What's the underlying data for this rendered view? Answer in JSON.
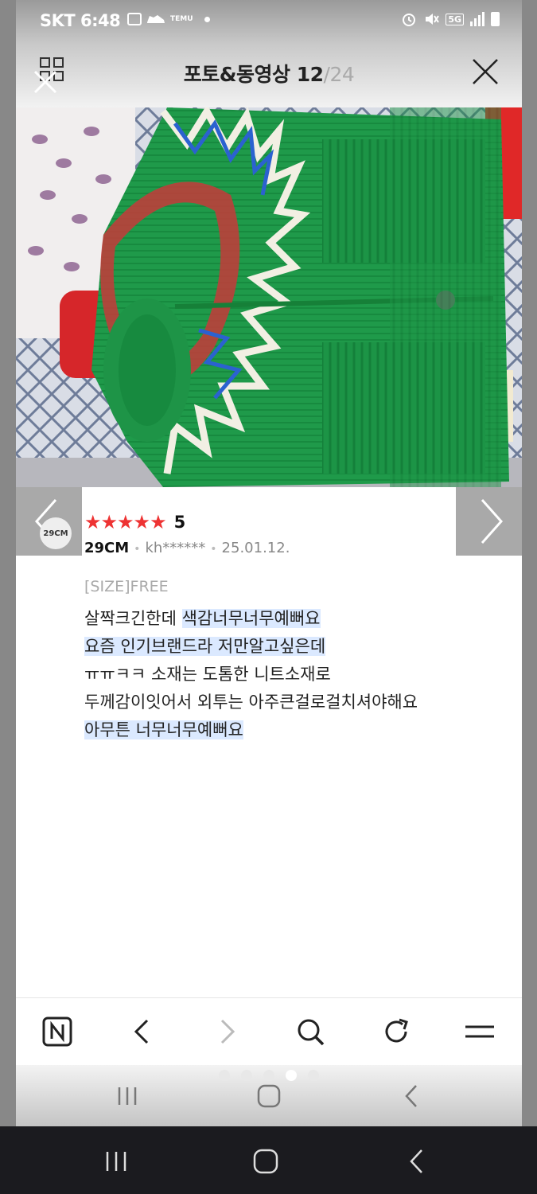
{
  "status_bar": {
    "time": "SKT 6:48",
    "left_icons": [
      "gallery-icon",
      "sneaker-icon",
      "temu-icon",
      "dot-icon"
    ],
    "temu_label": "TEMU",
    "network": "5G",
    "right_icons": [
      "alarm-icon",
      "mute-icon",
      "5g-icon",
      "signal-icon",
      "battery-icon"
    ]
  },
  "header": {
    "title": "포토&동영상",
    "current": "12",
    "separator": "/",
    "total": "24",
    "left_icon": "grid-icon",
    "close_icon": "close-icon"
  },
  "photo": {
    "description_icon": "review-photo"
  },
  "review": {
    "brand_logo_text": "29CM",
    "rating": "5",
    "stars": 5,
    "brand": "29CM",
    "user": "kh******",
    "date": "25.01.12.",
    "size": "[SIZE]FREE",
    "lines": [
      {
        "plain": "살짝크긴한데 ",
        "highlight": "색감너무너무예뻐요"
      },
      {
        "plain": "",
        "highlight": "요즘 인기브랜드라 저만알고싶은데"
      },
      {
        "plain": "ㅠㅠㅋㅋ 소재는 도톰한 니트소재로",
        "highlight": ""
      },
      {
        "plain": "두께감이잇어서 외투는 아주큰걸로걸치셔야해요",
        "highlight": ""
      },
      {
        "plain": "",
        "highlight": "아무튼 너무너무예뻐요"
      }
    ]
  },
  "toolbar": {
    "buttons": [
      "naver-home-icon",
      "back-icon",
      "forward-icon",
      "search-icon",
      "refresh-icon",
      "menu-icon"
    ]
  },
  "page_dots": {
    "count": 5,
    "active_index": 3
  },
  "nav": {
    "buttons": [
      "recents-icon",
      "home-icon",
      "back-icon"
    ]
  },
  "colors": {
    "star": "#ee3333",
    "highlight": "#dbe9ff",
    "accent_text": "#222222",
    "muted": "#888888"
  }
}
